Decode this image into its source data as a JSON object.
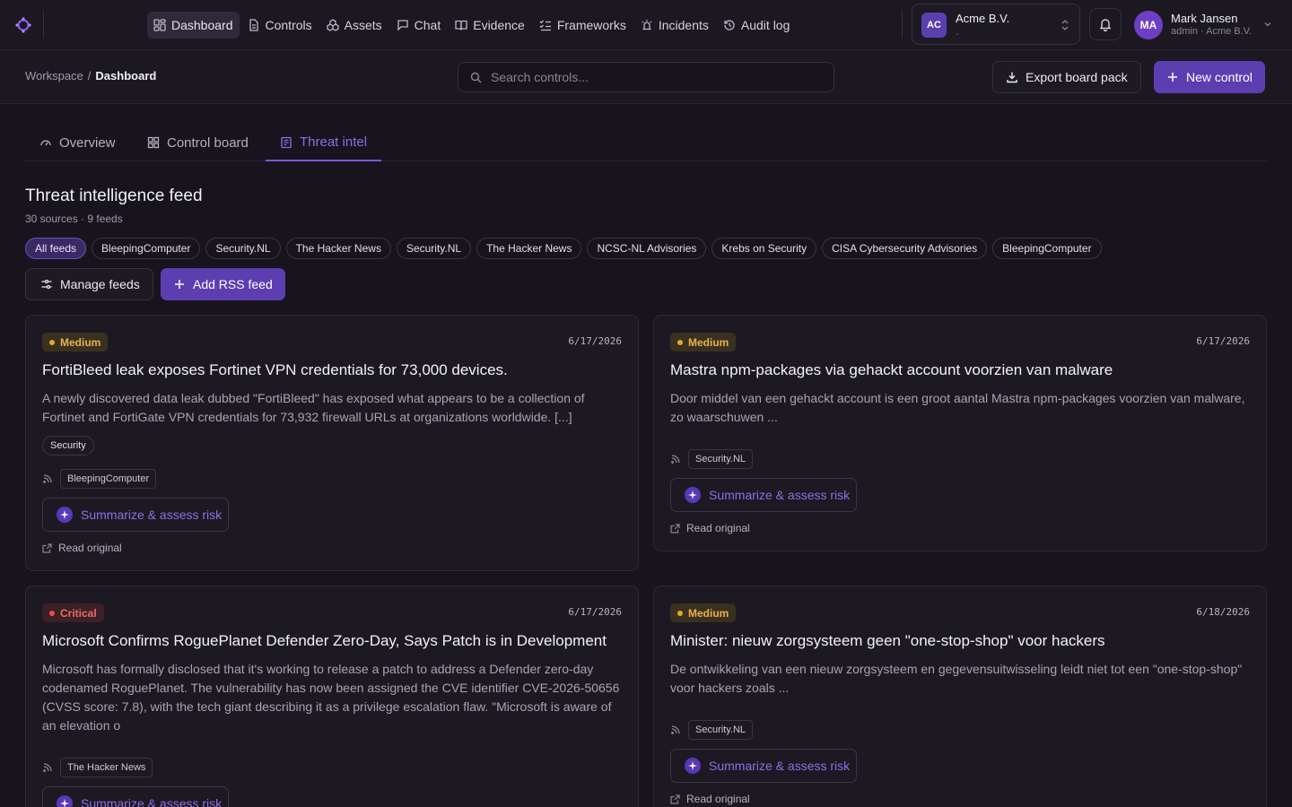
{
  "nav": {
    "items": [
      {
        "label": "Dashboard",
        "icon": "dashboard-icon",
        "active": true
      },
      {
        "label": "Controls",
        "icon": "document-icon"
      },
      {
        "label": "Assets",
        "icon": "boxes-icon"
      },
      {
        "label": "Chat",
        "icon": "chat-icon"
      },
      {
        "label": "Evidence",
        "icon": "book-icon"
      },
      {
        "label": "Frameworks",
        "icon": "checklist-icon"
      },
      {
        "label": "Incidents",
        "icon": "siren-icon"
      },
      {
        "label": "Audit log",
        "icon": "history-icon"
      }
    ]
  },
  "org": {
    "initials": "AC",
    "name": "Acme B.V.",
    "sub": "·"
  },
  "user": {
    "initials": "MA",
    "name": "Mark Jansen",
    "role": "admin · Acme B.V."
  },
  "breadcrumb": {
    "root": "Workspace",
    "sep": "/",
    "current": "Dashboard"
  },
  "search": {
    "placeholder": "Search controls..."
  },
  "actions": {
    "export_label": "Export board pack",
    "new_label": "New control"
  },
  "tabs": [
    {
      "label": "Overview",
      "icon": "gauge-icon"
    },
    {
      "label": "Control board",
      "icon": "grid-icon"
    },
    {
      "label": "Threat intel",
      "icon": "newspaper-icon",
      "active": true
    }
  ],
  "feed": {
    "title": "Threat intelligence feed",
    "summary": "30 sources · 9 feeds",
    "chips": [
      "All feeds",
      "BleepingComputer",
      "Security.NL",
      "The Hacker News",
      "Security.NL",
      "The Hacker News",
      "NCSC-NL Advisories",
      "Krebs on Security",
      "CISA Cybersecurity Advisories",
      "BleepingComputer"
    ],
    "manage_label": "Manage feeds",
    "add_label": "Add RSS feed"
  },
  "card_actions": {
    "summarize_label": "Summarize & assess risk",
    "read_label": "Read original"
  },
  "cards": [
    {
      "severity": "Medium",
      "date": "6/17/2026",
      "title": "FortiBleed leak exposes Fortinet VPN credentials for 73,000 devices.",
      "description": "A newly discovered data leak dubbed \"FortiBleed\" has exposed what appears to be a collection of Fortinet and FortiGate VPN credentials for 73,932 firewall URLs at organizations worldwide. [...]",
      "tag": "Security",
      "source": "BleepingComputer"
    },
    {
      "severity": "Medium",
      "date": "6/17/2026",
      "title": "Mastra npm-packages via gehackt account voorzien van malware",
      "description": "Door middel van een gehackt account is een groot aantal Mastra npm-packages voorzien van malware, zo waarschuwen ...",
      "source": "Security.NL"
    },
    {
      "severity": "Critical",
      "date": "6/17/2026",
      "title": "Microsoft Confirms RoguePlanet Defender Zero-Day, Says Patch is in Development",
      "description": "Microsoft has formally disclosed that it's working to release a patch to address a Defender zero-day codenamed RoguePlanet. The vulnerability has now been assigned the CVE identifier CVE-2026-50656 (CVSS score: 7.8), with the tech giant describing it as a privilege escalation flaw. \"Microsoft is aware of an elevation o",
      "source": "The Hacker News"
    },
    {
      "severity": "Medium",
      "date": "6/18/2026",
      "title": "Minister: nieuw zorgsysteem geen \"one-stop-shop\" voor hackers",
      "description": "De ontwikkeling van een nieuw zorgsysteem en gegevensuitwisseling leidt niet tot een \"one-stop-shop\" voor hackers zoals ...",
      "source": "Security.NL"
    }
  ]
}
